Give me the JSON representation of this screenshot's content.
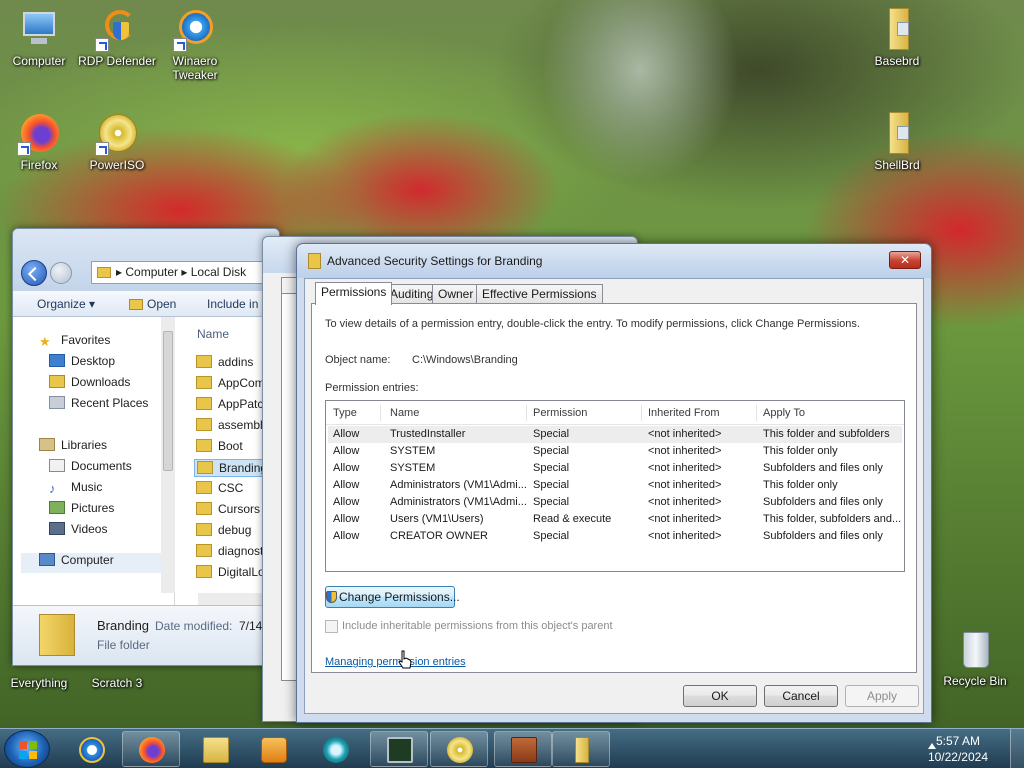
{
  "desktop": {
    "icons": [
      {
        "label": "Computer"
      },
      {
        "label": "RDP Defender"
      },
      {
        "label": "Winaero\nTweaker"
      },
      {
        "label": "Firefox"
      },
      {
        "label": "PowerISO"
      },
      {
        "label": "Basebrd"
      },
      {
        "label": "ShellBrd"
      },
      {
        "label": "Everything"
      },
      {
        "label": "Scratch 3"
      },
      {
        "label": "Recycle Bin"
      }
    ]
  },
  "explorer": {
    "address": [
      "Computer",
      "Local Disk"
    ],
    "toolbar": {
      "organize": "Organize ▾",
      "open": "Open",
      "include": "Include in"
    },
    "nav": {
      "favorites": "Favorites",
      "desktop": "Desktop",
      "downloads": "Downloads",
      "recent": "Recent Places",
      "libraries": "Libraries",
      "documents": "Documents",
      "music": "Music",
      "pictures": "Pictures",
      "videos": "Videos",
      "computer": "Computer"
    },
    "column_name": "Name",
    "files": [
      "addins",
      "AppCom",
      "AppPatc",
      "assembly",
      "Boot",
      "Branding",
      "CSC",
      "Cursors",
      "debug",
      "diagnost",
      "DigitalLo"
    ],
    "status": {
      "name": "Branding",
      "modified_label": "Date modified:",
      "modified_value": "7/14/",
      "type": "File folder"
    }
  },
  "dialog": {
    "title": "Advanced Security Settings for Branding",
    "close": "✕",
    "tabs": [
      "Permissions",
      "Auditing",
      "Owner",
      "Effective Permissions"
    ],
    "intro": "To view details of a permission entry, double-click the entry. To modify permissions, click Change Permissions.",
    "object_name_label": "Object name:",
    "object_name_value": "C:\\Windows\\Branding",
    "entries_label": "Permission entries:",
    "columns": [
      "Type",
      "Name",
      "Permission",
      "Inherited From",
      "Apply To"
    ],
    "entries": [
      {
        "type": "Allow",
        "name": "TrustedInstaller",
        "permission": "Special",
        "inherited": "<not inherited>",
        "apply": "This folder and subfolders"
      },
      {
        "type": "Allow",
        "name": "SYSTEM",
        "permission": "Special",
        "inherited": "<not inherited>",
        "apply": "This folder only"
      },
      {
        "type": "Allow",
        "name": "SYSTEM",
        "permission": "Special",
        "inherited": "<not inherited>",
        "apply": "Subfolders and files only"
      },
      {
        "type": "Allow",
        "name": "Administrators (VM1\\Admi...",
        "permission": "Special",
        "inherited": "<not inherited>",
        "apply": "This folder only"
      },
      {
        "type": "Allow",
        "name": "Administrators (VM1\\Admi...",
        "permission": "Special",
        "inherited": "<not inherited>",
        "apply": "Subfolders and files only"
      },
      {
        "type": "Allow",
        "name": "Users (VM1\\Users)",
        "permission": "Read & execute",
        "inherited": "<not inherited>",
        "apply": "This folder, subfolders and..."
      },
      {
        "type": "Allow",
        "name": "CREATOR OWNER",
        "permission": "Special",
        "inherited": "<not inherited>",
        "apply": "Subfolders and files only"
      }
    ],
    "change_permissions": "Change Permissions...",
    "include_inheritable": "Include inheritable permissions from this object's parent",
    "managing_link": "Managing permission entries",
    "ok": "OK",
    "cancel": "Cancel",
    "apply": "Apply"
  },
  "taskbar": {
    "time": "5:57 AM",
    "date": "10/22/2024"
  },
  "colors": {
    "accent_blue": "#2156b8",
    "link": "#0b5ba8",
    "close_red": "#c8412e"
  }
}
